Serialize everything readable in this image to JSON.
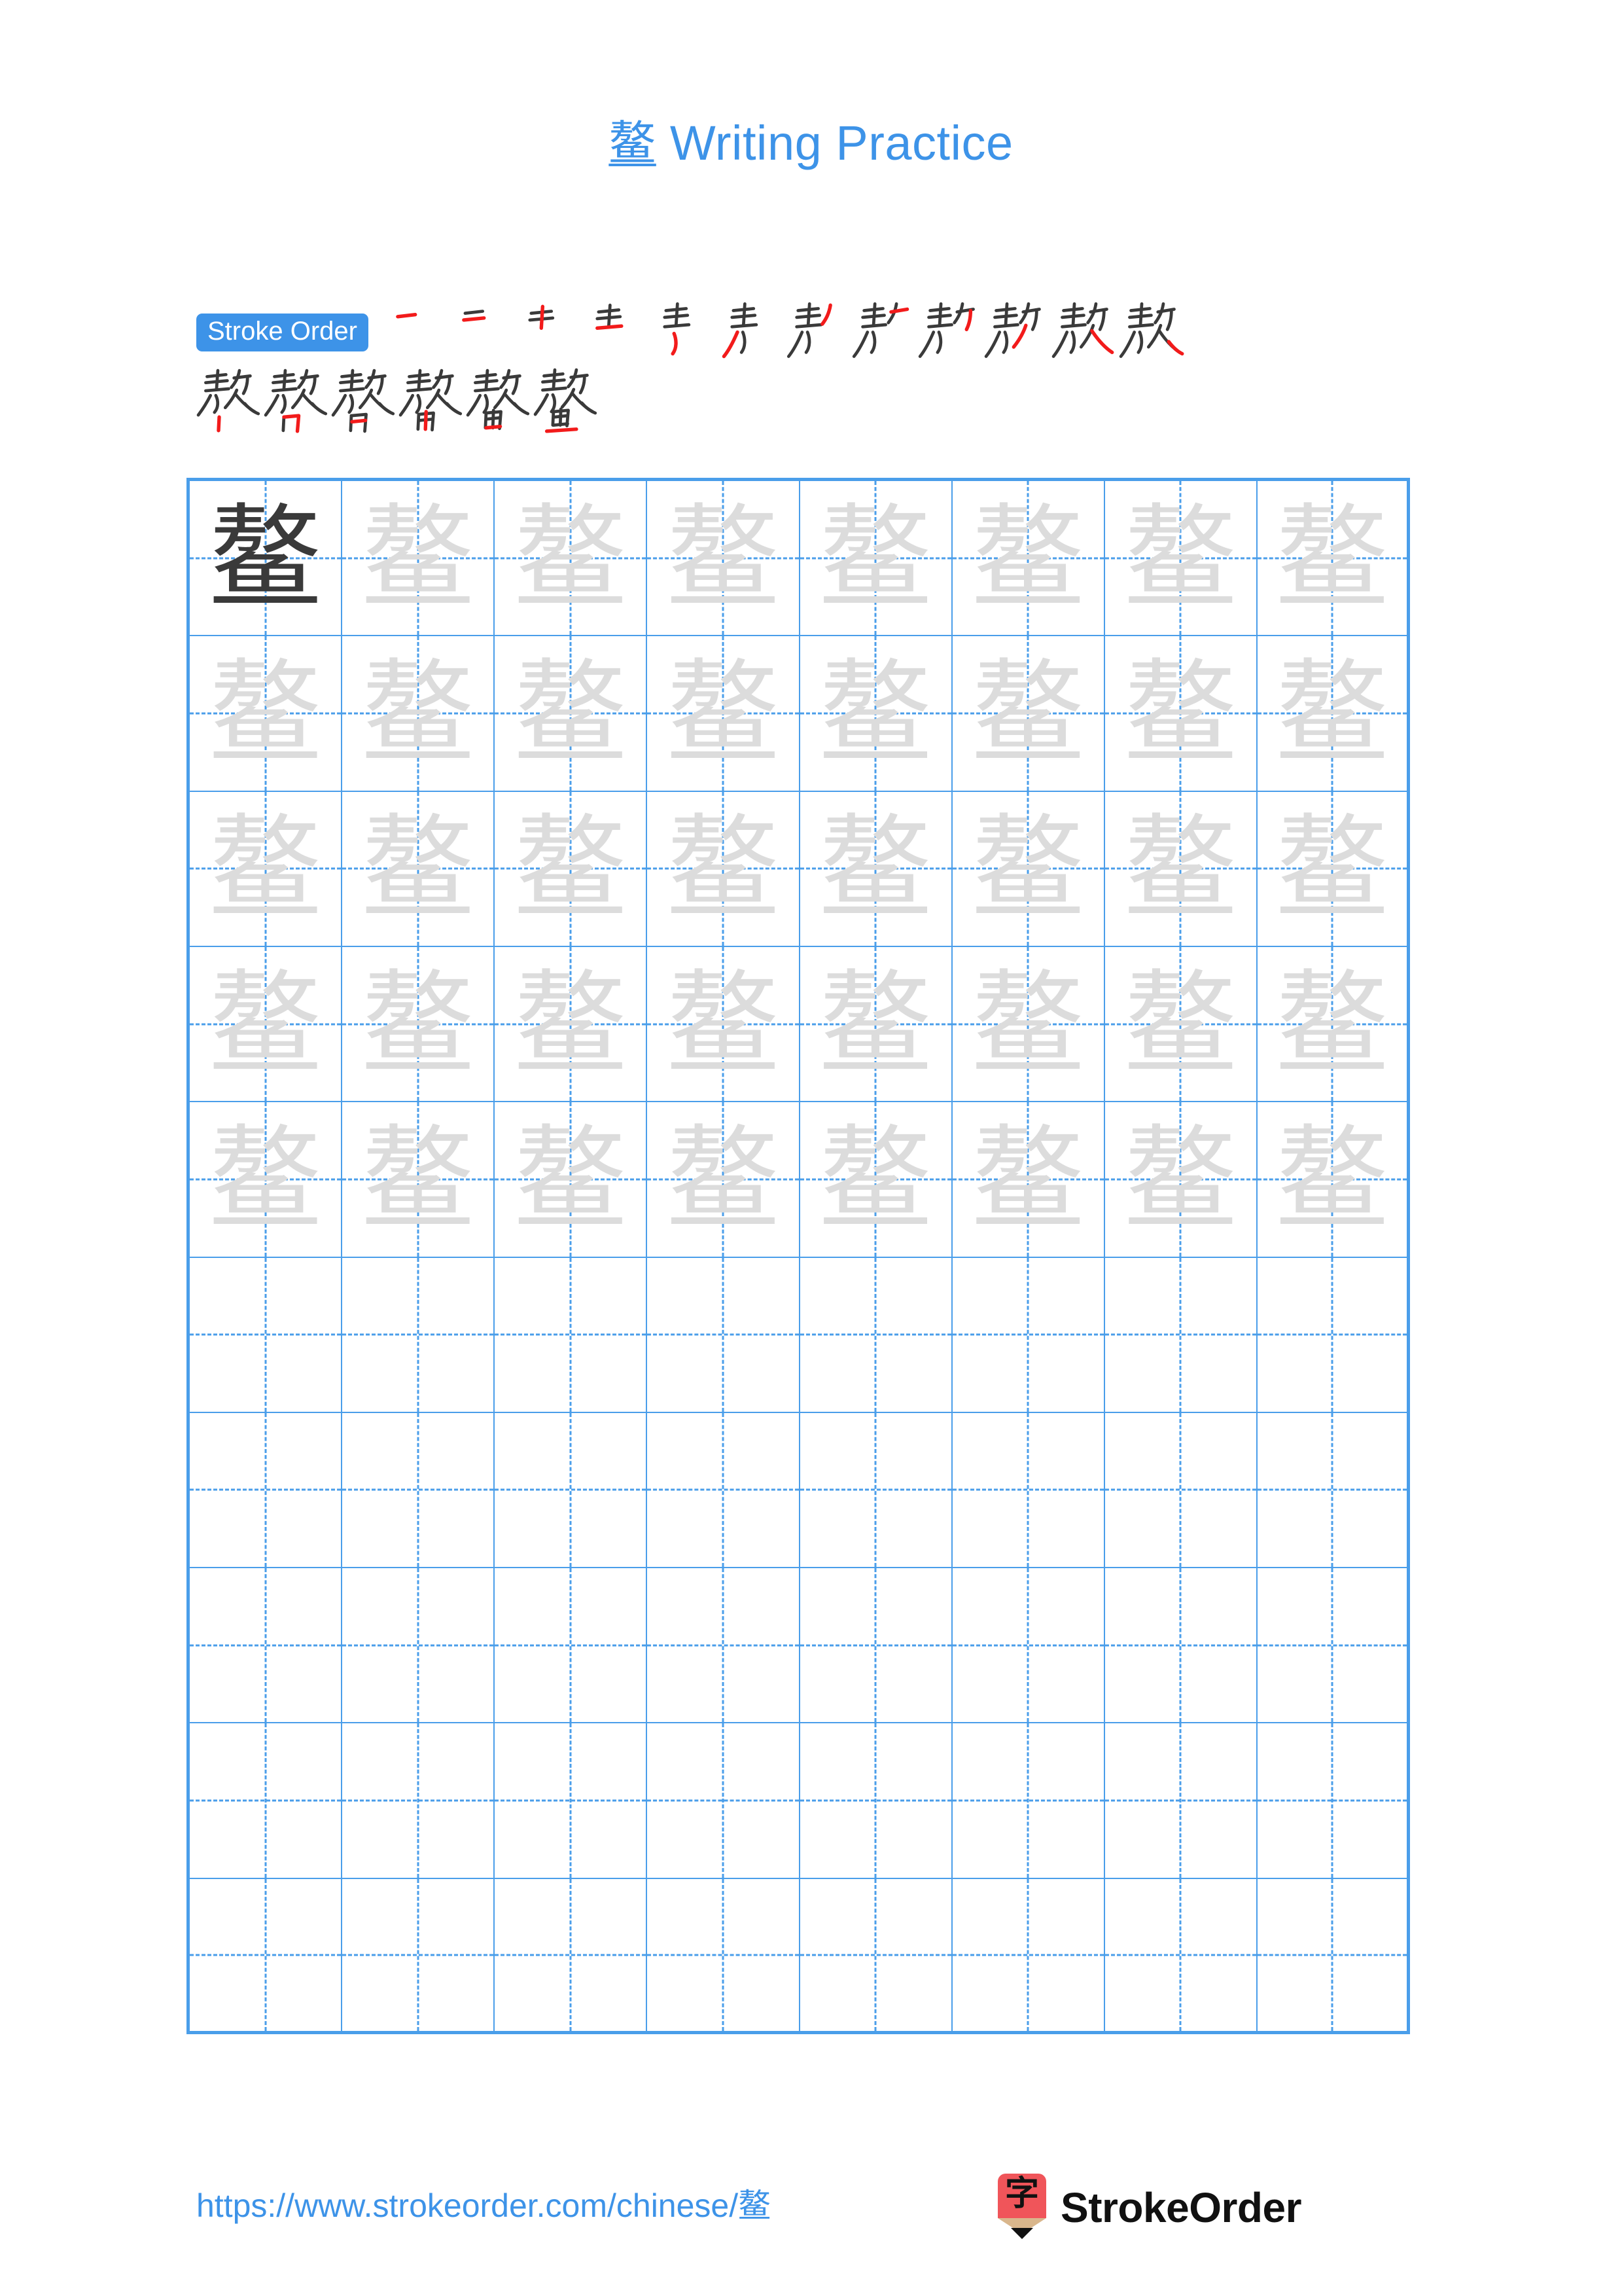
{
  "page": {
    "character": "鳌",
    "title_suffix": " Writing Practice",
    "accent_color": "#3d93e8",
    "grid_line_color": "#4a9eea",
    "stroke_new_color": "#f21b1b",
    "stroke_old_color": "#3a3a3a",
    "ghost_color": "#dcdcdc"
  },
  "stroke_order": {
    "badge_label": "Stroke Order",
    "total_strokes": 18,
    "row1_count": 12,
    "row2_count": 6,
    "steps": [
      {
        "index": 1,
        "label": "stroke-1"
      },
      {
        "index": 2,
        "label": "stroke-2"
      },
      {
        "index": 3,
        "label": "stroke-3"
      },
      {
        "index": 4,
        "label": "stroke-4"
      },
      {
        "index": 5,
        "label": "stroke-5"
      },
      {
        "index": 6,
        "label": "stroke-6"
      },
      {
        "index": 7,
        "label": "stroke-7"
      },
      {
        "index": 8,
        "label": "stroke-8"
      },
      {
        "index": 9,
        "label": "stroke-9"
      },
      {
        "index": 10,
        "label": "stroke-10"
      },
      {
        "index": 11,
        "label": "stroke-11"
      },
      {
        "index": 12,
        "label": "stroke-12"
      },
      {
        "index": 13,
        "label": "stroke-13"
      },
      {
        "index": 14,
        "label": "stroke-14"
      },
      {
        "index": 15,
        "label": "stroke-15"
      },
      {
        "index": 16,
        "label": "stroke-16"
      },
      {
        "index": 17,
        "label": "stroke-17"
      },
      {
        "index": 18,
        "label": "stroke-18"
      }
    ]
  },
  "practice_grid": {
    "columns": 8,
    "rows": 10,
    "filled_rows": 5,
    "empty_rows": 5,
    "model_cell": {
      "row": 1,
      "column": 1,
      "style": "dark"
    },
    "tracing_style": "ghost",
    "character": "鳌"
  },
  "footer": {
    "url": "https://www.strokeorder.com/chinese/",
    "url_character": "鳌",
    "logo_mark_character": "字",
    "logo_text": "StrokeOrder"
  }
}
